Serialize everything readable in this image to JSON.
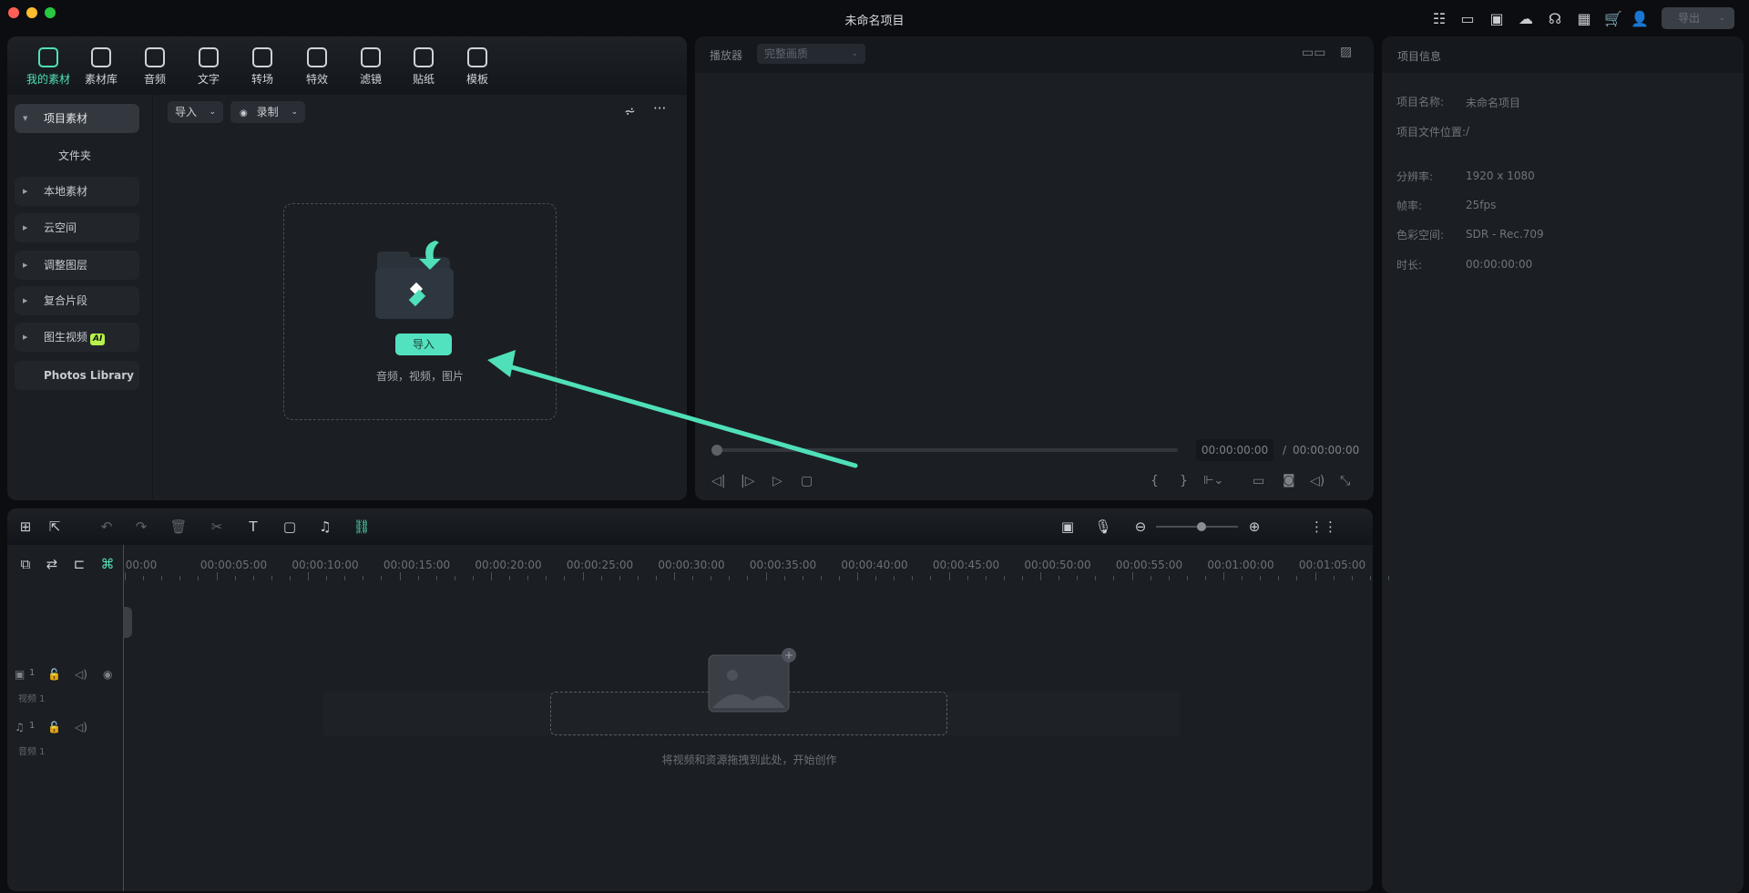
{
  "window": {
    "title": "未命名项目"
  },
  "topbar": {
    "icons": [
      "task-list-icon",
      "layout-icon",
      "save-icon",
      "cloud-upload-icon",
      "headset-icon",
      "apps-icon",
      "cart-icon",
      "user-icon"
    ],
    "export_label": "导出",
    "cart_color": "#ff3d9a",
    "accent": "#4fe0b9"
  },
  "media_tabs": [
    {
      "label": "我的素材",
      "icon": "my-media-icon"
    },
    {
      "label": "素材库",
      "icon": "store-icon"
    },
    {
      "label": "音频",
      "icon": "music-icon"
    },
    {
      "label": "文字",
      "icon": "text-icon"
    },
    {
      "label": "转场",
      "icon": "transition-icon"
    },
    {
      "label": "特效",
      "icon": "effects-icon"
    },
    {
      "label": "滤镜",
      "icon": "filter-icon"
    },
    {
      "label": "贴纸",
      "icon": "sticker-icon"
    },
    {
      "label": "模板",
      "icon": "template-icon"
    }
  ],
  "sidebar": {
    "items": [
      {
        "label": "项目素材"
      },
      {
        "label": "文件夹"
      },
      {
        "label": "本地素材"
      },
      {
        "label": "云空间"
      },
      {
        "label": "调整图层"
      },
      {
        "label": "复合片段"
      },
      {
        "label": "图生视频",
        "badge": "AI"
      },
      {
        "label": "Photos Library"
      }
    ]
  },
  "media_toolbar": {
    "import_label": "导入",
    "record_label": "录制"
  },
  "dropzone": {
    "button": "导入",
    "hint": "音频，视频，图片"
  },
  "player": {
    "title": "播放器",
    "quality": "完整画质",
    "current_time": "00:00:00:00",
    "separator": "/",
    "total_time": "00:00:00:00",
    "progress": 0
  },
  "project_info": {
    "title": "项目信息",
    "rows": [
      {
        "label": "项目名称:",
        "value": "未命名项目"
      },
      {
        "label": "项目文件位置:",
        "value": "/"
      },
      {
        "label": "分辨率:",
        "value": "1920 x 1080"
      },
      {
        "label": "帧率:",
        "value": "25fps"
      },
      {
        "label": "色彩空间:",
        "value": "SDR - Rec.709"
      },
      {
        "label": "时长:",
        "value": "00:00:00:00"
      }
    ]
  },
  "timeline": {
    "ruler": [
      "00:00",
      "00:00:05:00",
      "00:00:10:00",
      "00:00:15:00",
      "00:00:20:00",
      "00:00:25:00",
      "00:00:30:00",
      "00:00:35:00",
      "00:00:40:00",
      "00:00:45:00",
      "00:00:50:00",
      "00:00:55:00",
      "00:01:00:00",
      "00:01:05:00"
    ],
    "tracks": [
      {
        "label": "视频 1",
        "num": "1"
      },
      {
        "label": "音频 1",
        "num": "1"
      }
    ],
    "empty_hint": "将视频和资源拖拽到此处，开始创作",
    "zoom_level": 0.75
  }
}
